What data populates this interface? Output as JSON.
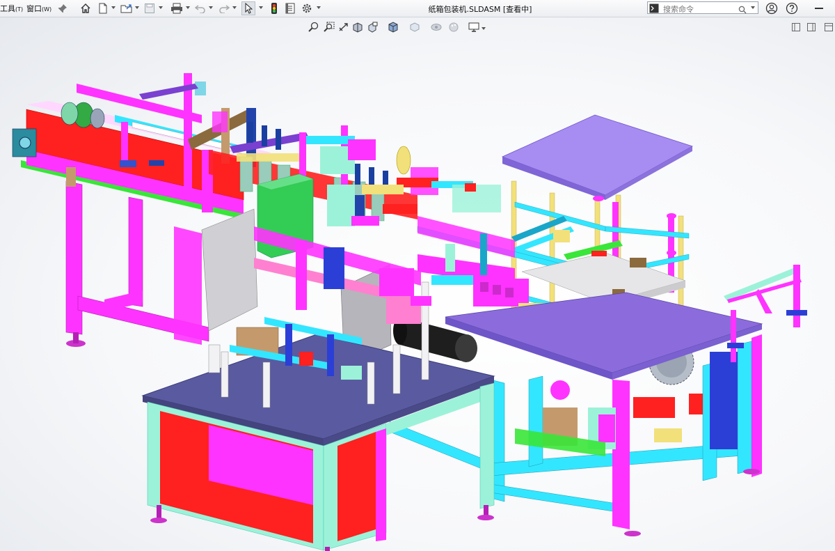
{
  "menu": {
    "tools_label": "工具",
    "tools_key": "(T)",
    "window_label": "窗口",
    "window_key": "(W)"
  },
  "window": {
    "title": "纸箱包装机.SLDASM [查看中]"
  },
  "search": {
    "placeholder": "搜索命令"
  },
  "colors": {
    "magenta": "#ff33ff",
    "cyan": "#33e6ff",
    "mint": "#9cf2d8",
    "red": "#ff2020",
    "lavender": "#a78cf2",
    "slate": "#5a5aa0",
    "yellow": "#f2e07a"
  }
}
